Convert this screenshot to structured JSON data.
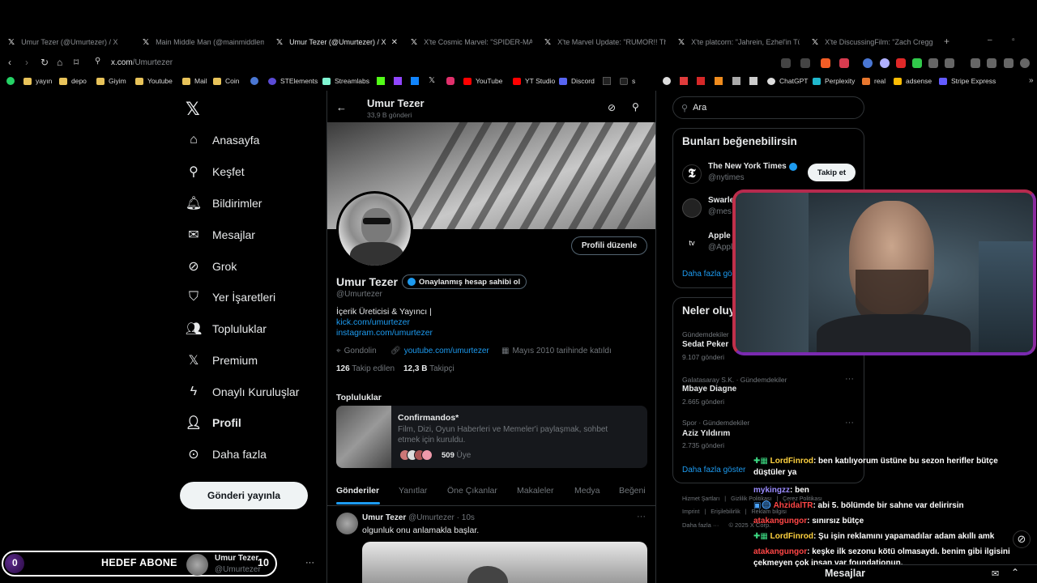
{
  "browser": {
    "tabs": [
      {
        "label": "Umur Tezer (@Umurtezer) / X",
        "active": false
      },
      {
        "label": "Main Middle Man (@mainmiddlema",
        "active": false
      },
      {
        "label": "Umur Tezer (@Umurtezer) / X",
        "active": true
      },
      {
        "label": "X'te Cosmic Marvel: \"SPIDER-MAN:",
        "active": false
      },
      {
        "label": "X'te Marvel Update: \"RUMOR!! The s",
        "active": false
      },
      {
        "label": "X'te platcorn: \"Jahrein, Ezhel'in Türk",
        "active": false
      },
      {
        "label": "X'te DiscussingFilm: \"Zach Cregger's",
        "active": false
      }
    ],
    "url_host": "x.com",
    "url_path": "/Umurtezer",
    "bookmarks": [
      "yayın",
      "depo",
      "Giyim",
      "Youtube",
      "Mail",
      "Coin",
      "STElements",
      "Streamlabs",
      "YouTube",
      "YT Studio",
      "Discord",
      "s",
      "ChatGPT",
      "Perplexity",
      "real",
      "adsense",
      "Stripe Express"
    ]
  },
  "nav": {
    "items": [
      "Anasayfa",
      "Keşfet",
      "Bildirimler",
      "Mesajlar",
      "Grok",
      "Yer İşaretleri",
      "Topluluklar",
      "Premium",
      "Onaylı Kuruluşlar",
      "Profil",
      "Daha fazla"
    ],
    "post_button": "Gönderi yayınla"
  },
  "profile": {
    "header_name": "Umur Tezer",
    "header_count": "33,9 B gönderi",
    "name": "Umur Tezer",
    "verify_badge": "Onaylanmış hesap sahibi ol",
    "handle": "@Umurtezer",
    "edit_button": "Profili düzenle",
    "bio_line": "İçerik Üreticisi & Yayıncı |",
    "bio_link1": "kick.com/umurtezer",
    "bio_link2": "instagram.com/umurtezer",
    "location": "Gondolin",
    "website": "youtube.com/umurtezer",
    "joined": "Mayıs 2010 tarihinde katıldı",
    "following_count": "126",
    "following_label": "Takip edilen",
    "followers_count": "12,3 B",
    "followers_label": "Takipçi",
    "communities_title": "Topluluklar",
    "community": {
      "name": "Confirmandos*",
      "desc1": "Film, Dizi, Oyun Haberleri ve Memeler'i paylaşmak, sohbet",
      "desc2": "etmek için kuruldu.",
      "members": "509",
      "members_label": "Üye"
    },
    "tabs": [
      "Gönderiler",
      "Yanıtlar",
      "Öne Çıkanlar",
      "Makaleler",
      "Medya",
      "Beğeni"
    ],
    "post": {
      "name": "Umur Tezer",
      "handle": "@Umurtezer",
      "time": "· 10s",
      "text": "olgunluk onu anlamakla başlar."
    }
  },
  "right": {
    "search_placeholder": "Ara",
    "suggest_title": "Bunları beğenebilirsin",
    "suggestions": [
      {
        "name": "The New York Times",
        "handle": "@nytimes"
      },
      {
        "name": "Swarle",
        "handle": "@mes"
      },
      {
        "name": "Apple",
        "handle": "@Appl"
      }
    ],
    "follow_button": "Takip et",
    "show_more": "Daha fazla gös",
    "trends_title": "Neler oluy",
    "trends": [
      {
        "context": "Gündemdekiler",
        "name": "Sedat Peker",
        "count": "9.107 gönderi"
      },
      {
        "context": "Galatasaray S.K. · Gündemdekiler",
        "name": "Mbaye Diagne",
        "count": "2.665 gönderi"
      },
      {
        "context": "Spor · Gündemdekiler",
        "name": "Aziz Yıldırım",
        "count": "2.735 gönderi"
      }
    ],
    "trends_more": "Daha fazla göster",
    "footer1": [
      "Hizmet Şartları",
      "|",
      "Gizlilik Politikası",
      "|",
      "Çerez Politikası"
    ],
    "footer2": [
      "Imprint",
      "|",
      "Erişilebilirlik",
      "|",
      "Reklam bilgisi"
    ],
    "footer3": [
      "Daha fazla ···",
      "© 2025 X Corp."
    ]
  },
  "overlay": {
    "goal_count": "0",
    "goal_label": "HEDEF ABONE",
    "goal_target": "10",
    "mini_profile_name": "Umur Tezer",
    "mini_profile_handle": "@Umurtezer",
    "messages_drawer": "Mesajlar",
    "chat": [
      {
        "user": "LordFinrod",
        "text": ": ben katılıyorum üstüne bu sezon herifler bütçe düştüler ya"
      },
      {
        "user": "mykingzz",
        "text": ": ben"
      },
      {
        "user": "AhzidalTR",
        "text": ": abi 5. bölümde bir sahne var delirirsin"
      },
      {
        "user": "atakangungor",
        "text": ": sınırsız bütçe"
      },
      {
        "user": "LordFinrod",
        "text": ": Şu işin reklamını yapamadılar adam akıllı amk"
      },
      {
        "user": "atakangungor",
        "text": ": keşke ilk sezonu kötü olmasaydı. benim gibi ilgisini çekmeyen çok insan var foundationun."
      }
    ]
  },
  "colors": {
    "accent": "#1d9bf0",
    "chat_username": "#ffd23f",
    "webcam_border": "#b62a4e"
  }
}
